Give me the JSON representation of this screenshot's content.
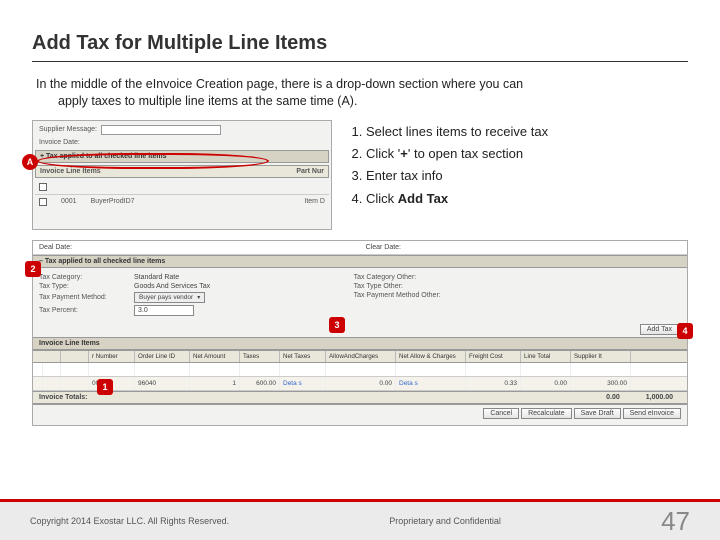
{
  "title": "Add Tax for Multiple Line Items",
  "intro_line1": "In the middle of the eInvoice Creation page, there is a drop-down section where you can",
  "intro_line2": "apply taxes to multiple line items at the same time (A).",
  "steps": [
    "Select lines items to receive tax",
    "Click '+' to open tax section",
    "Enter tax info",
    "Click Add Tax"
  ],
  "step4_prefix": "Click ",
  "step4_bold": "Add Tax",
  "badges": {
    "A": "A",
    "n1": "1",
    "n2": "2",
    "n3": "3",
    "n4": "4"
  },
  "shotA": {
    "supplier_msg": "Supplier Message:",
    "inv_date": "Invoice Date:",
    "tax_bar": "+ Tax applied to all checked line items",
    "header_left": "Invoice Line Items",
    "header_right": "Part Nur",
    "row_id": "0001",
    "row_prod": "BuyerProdID7",
    "row_item": "Item D"
  },
  "shotB": {
    "date_left": "Deal Date:",
    "date_right": "Clear Date:",
    "tax_bar": "– Tax applied to all checked line items",
    "form": {
      "cat_lbl": "Tax Category:",
      "cat_val": "Standard Rate",
      "type_lbl": "Tax Type:",
      "type_val": "Goods And Services Tax",
      "pay_lbl": "Tax Payment Method:",
      "pay_val": "Buyer pays vendor",
      "pct_lbl": "Tax Percent:",
      "pct_val": "3.0",
      "catoth_lbl": "Tax Category Other:",
      "typeoth_lbl": "Tax Type Other:",
      "payoth_lbl": "Tax Payment Method Other:"
    },
    "add_tax_btn": "Add Tax",
    "line_bar": "Invoice Line Items",
    "grid_headers": [
      "",
      "",
      "r Number",
      "Order Line ID",
      "Net Amount",
      "Taxes",
      "Net Taxes",
      "AllowAndCharges",
      "Net Allow & Charges",
      "Freight Cost",
      "Line Total",
      "Supplier It"
    ],
    "grid_row": [
      "",
      "",
      "0001",
      "96040",
      "1",
      "600.00",
      "Deta s",
      "0.00",
      "Deta s",
      "0.33",
      "",
      "0.00",
      "300.00"
    ],
    "totals_lbl": "Invoice Totals:",
    "totals_vals": [
      "0.00",
      "1,000.00"
    ],
    "buttons": [
      "Cancel",
      "Recalculate",
      "Save Draft",
      "Send eInvoice"
    ]
  },
  "footer": {
    "copyright": "Copyright 2014 Exostar LLC. All Rights Reserved.",
    "confidential": "Proprietary and Confidential",
    "page": "47"
  }
}
